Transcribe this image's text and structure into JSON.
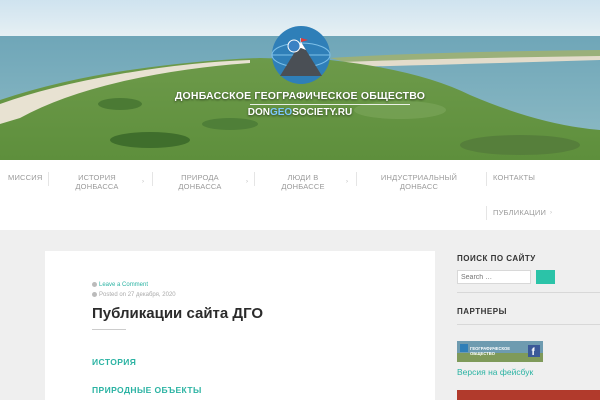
{
  "header": {
    "site_title": "ДОНБАССКОЕ ГЕОГРАФИЧЕСКОЕ ОБЩЕСТВО",
    "domain_prefix": "DON",
    "domain_accent": "GEO",
    "domain_suffix": "SOCIETY.RU"
  },
  "nav": {
    "items": [
      {
        "label_1": "МИССИЯ",
        "label_2": ""
      },
      {
        "label_1": "ИСТОРИЯ",
        "label_2": "ДОНБАССА"
      },
      {
        "label_1": "ПРИРОДА",
        "label_2": "ДОНБАССА"
      },
      {
        "label_1": "ЛЮДИ В",
        "label_2": "ДОНБАССЕ"
      },
      {
        "label_1": "ИНДУСТРИАЛЬНЫЙ",
        "label_2": "ДОНБАСС"
      },
      {
        "label_1": "КОНТАКТЫ",
        "label_2": ""
      },
      {
        "label_1": "ПУБЛИКАЦИИ",
        "label_2": ""
      }
    ],
    "submenu_arrow": "›"
  },
  "post": {
    "comment_link": "Leave a Comment",
    "posted_on_prefix": "Posted on",
    "date": "27 декабря, 2020",
    "title": "Публикации сайта ДГО",
    "categories": [
      "ИСТОРИЯ",
      "ПРИРОДНЫЕ ОБЪЕКТЫ"
    ]
  },
  "sidebar": {
    "search_heading": "ПОИСК ПО САЙТУ",
    "search_placeholder": "Search …",
    "partners_heading": "ПАРТНЕРЫ",
    "banner_text_1": "ГЕОГРАФИЧЕСКОЕ",
    "banner_text_2": "ОБЩЕСТВО",
    "banner_fb": "f",
    "fb_link": "Версия на фейсбук"
  },
  "colors": {
    "accent": "#2bb3a3",
    "search_button": "#2bc3a8",
    "card_bg": "#ffffff",
    "page_bg": "#efefef"
  }
}
